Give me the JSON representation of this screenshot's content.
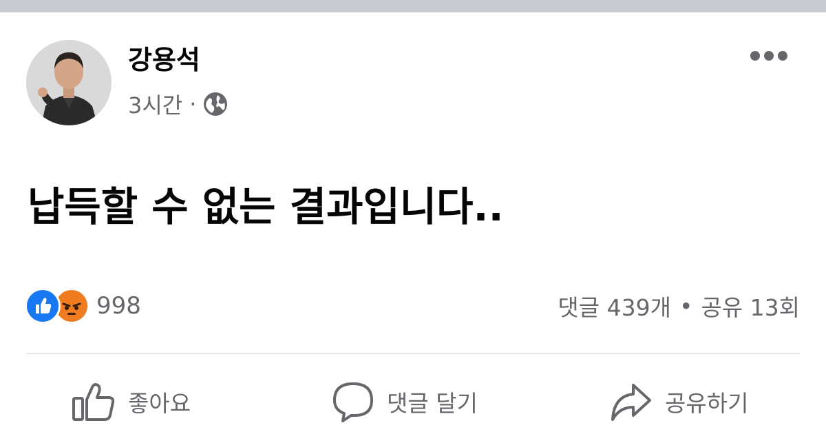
{
  "post": {
    "author": "강용석",
    "time": "3시간",
    "separator": "·",
    "privacy_icon": "globe-icon",
    "more_icon": "more-dots-icon",
    "text": "납득할 수 없는 결과입니다.."
  },
  "reactions": {
    "icons": [
      "like-icon",
      "angry-icon"
    ],
    "count": "998"
  },
  "stats": {
    "comments": "댓글 439개",
    "separator": "•",
    "shares": "공유 13회"
  },
  "actions": {
    "like": "좋아요",
    "comment": "댓글 달기",
    "share": "공유하기"
  },
  "colors": {
    "like_blue": "#1877f2",
    "angry_orange": "#f07c21",
    "secondary_text": "#65676b",
    "top_strip": "#c9ccd1"
  }
}
